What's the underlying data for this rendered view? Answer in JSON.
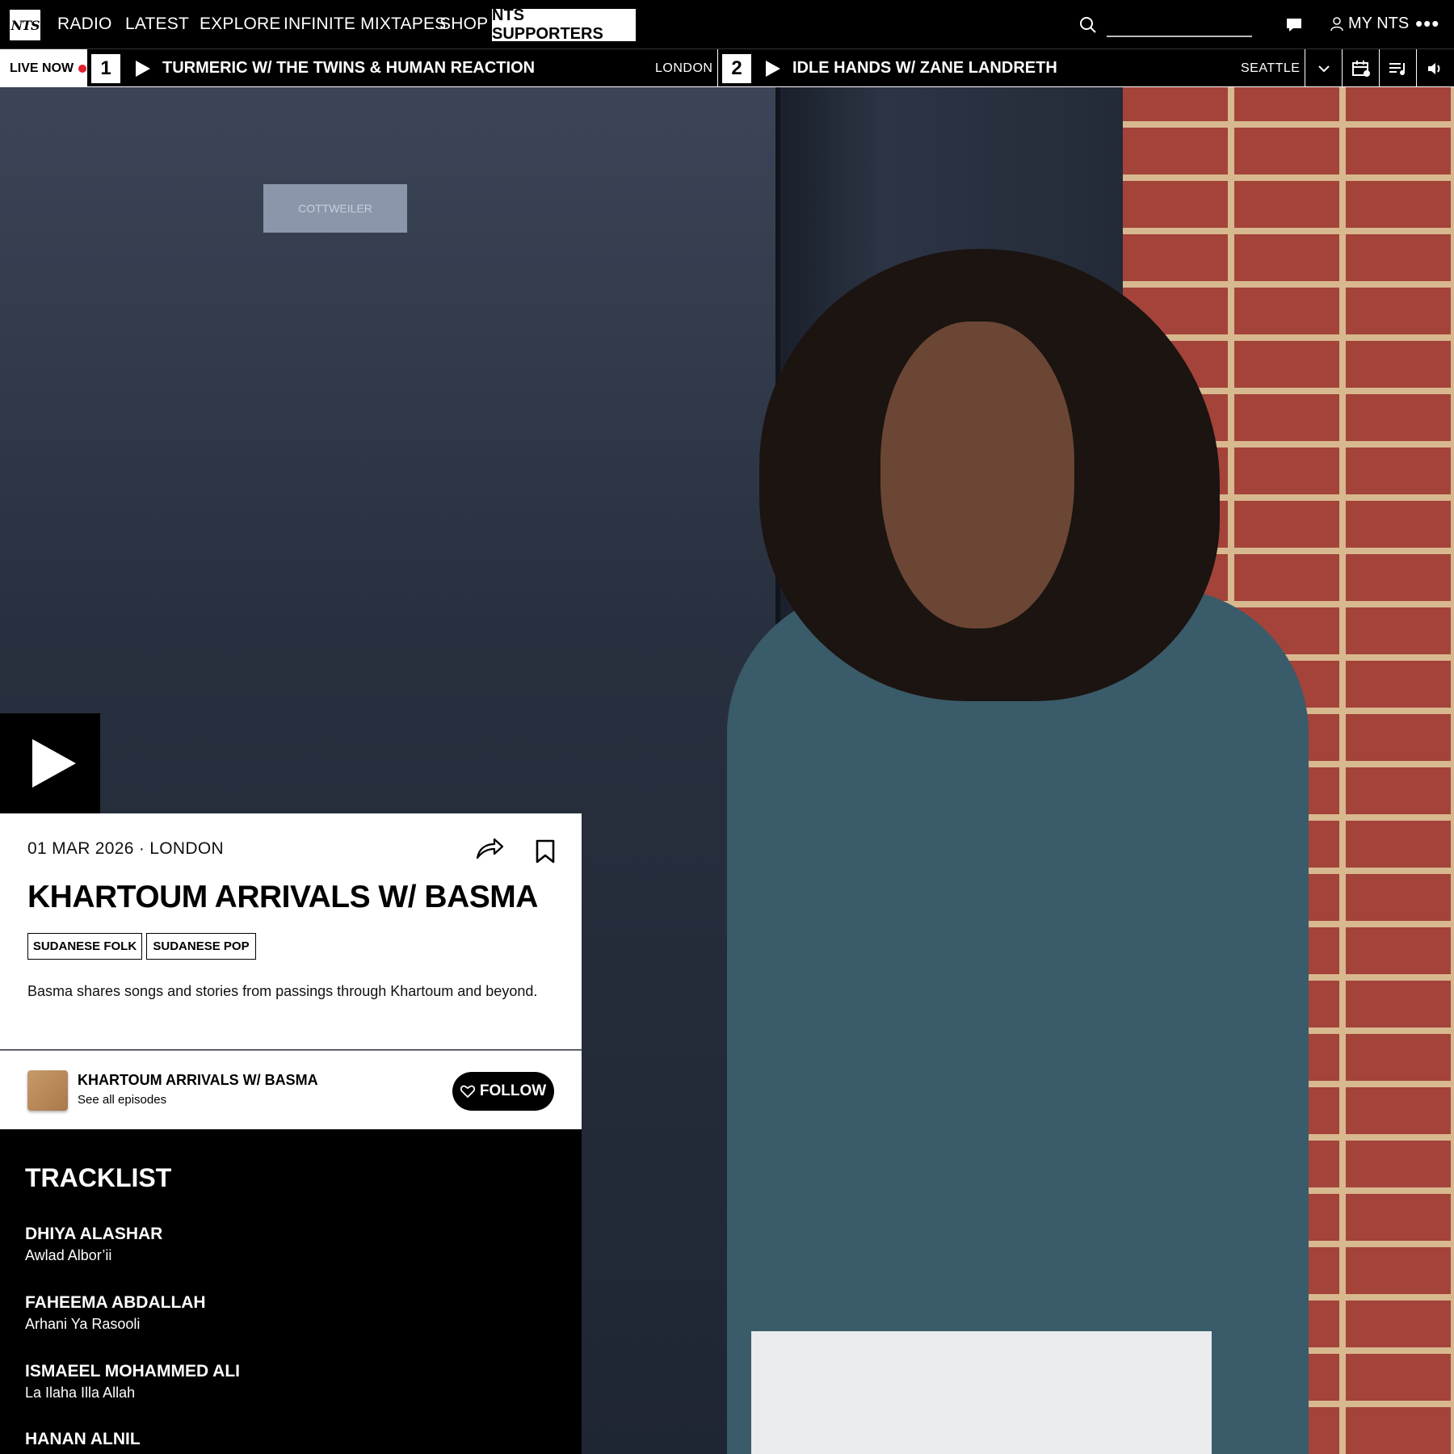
{
  "nav": {
    "logo": "NTS",
    "items": [
      "RADIO",
      "LATEST",
      "EXPLORE",
      "INFINITE MIXTAPES",
      "SHOP"
    ],
    "supporters": "NTS SUPPORTERS",
    "search_placeholder": "",
    "my_nts": "MY NTS",
    "more": "•••"
  },
  "live": {
    "label": "LIVE NOW",
    "channels": [
      {
        "number": "1",
        "title": "TURMERIC W/ THE TWINS & HUMAN REACTION",
        "city": "LONDON"
      },
      {
        "number": "2",
        "title": "IDLE HANDS W/ ZANE LANDRETH",
        "city": "SEATTLE"
      }
    ]
  },
  "hero": {
    "plaque_text": "COTTWEILER"
  },
  "episode": {
    "date": "01 MAR 2026",
    "location": "LONDON",
    "title": "KHARTOUM ARRIVALS W/ BASMA",
    "tags": [
      "SUDANESE FOLK",
      "SUDANESE POP"
    ],
    "description": "Basma shares songs and stories from passings through Khartoum and beyond."
  },
  "host": {
    "name": "KHARTOUM ARRIVALS W/ BASMA",
    "sub": "See all episodes",
    "follow": "FOLLOW"
  },
  "tracklist": {
    "heading": "TRACKLIST",
    "tracks": [
      {
        "artist": "DHIYA ALASHAR",
        "title": "Awlad Albor’ii"
      },
      {
        "artist": "FAHEEMA ABDALLAH",
        "title": "Arhani Ya Rasooli"
      },
      {
        "artist": "ISMAEEL MOHAMMED ALI",
        "title": "La Ilaha Illa Allah"
      },
      {
        "artist": "HANAN ALNIL",
        "title": ""
      }
    ]
  },
  "colors": {
    "accent_live": "#e0202a",
    "background": "#000000",
    "card": "#ffffff"
  }
}
